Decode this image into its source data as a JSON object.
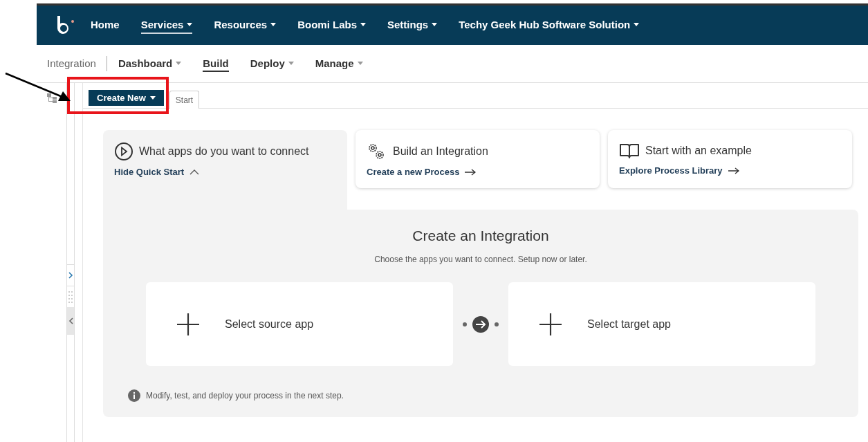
{
  "nav": {
    "items": [
      {
        "label": "Home",
        "dropdown": false,
        "selected": false
      },
      {
        "label": "Services",
        "dropdown": true,
        "selected": true
      },
      {
        "label": "Resources",
        "dropdown": true,
        "selected": false
      },
      {
        "label": "Boomi Labs",
        "dropdown": true,
        "selected": false
      },
      {
        "label": "Settings",
        "dropdown": true,
        "selected": false
      },
      {
        "label": "Techy Geek Hub Software Solution",
        "dropdown": true,
        "selected": false
      }
    ]
  },
  "subnav": {
    "app": "Integration",
    "items": [
      {
        "label": "Dashboard",
        "dropdown": true,
        "selected": false
      },
      {
        "label": "Build",
        "dropdown": false,
        "selected": true
      },
      {
        "label": "Deploy",
        "dropdown": true,
        "selected": false
      },
      {
        "label": "Manage",
        "dropdown": true,
        "selected": false
      }
    ]
  },
  "toolbar": {
    "create_button": "Create New",
    "tabs": [
      {
        "label": "Start",
        "selected": true
      }
    ]
  },
  "quick_start": {
    "tabs": [
      {
        "title": "What apps do you want to connect",
        "link": "Hide Quick Start",
        "selected": true
      },
      {
        "title": "Build an Integration",
        "link": "Create a new Process",
        "selected": false
      },
      {
        "title": "Start with an example",
        "link": "Explore Process Library",
        "selected": false
      }
    ]
  },
  "integration": {
    "title": "Create an Integration",
    "subtitle": "Choose the apps you want to connect. Setup now or later.",
    "source": "Select source app",
    "target": "Select target app",
    "note": "Modify, test, and deploy your process in the next step."
  }
}
